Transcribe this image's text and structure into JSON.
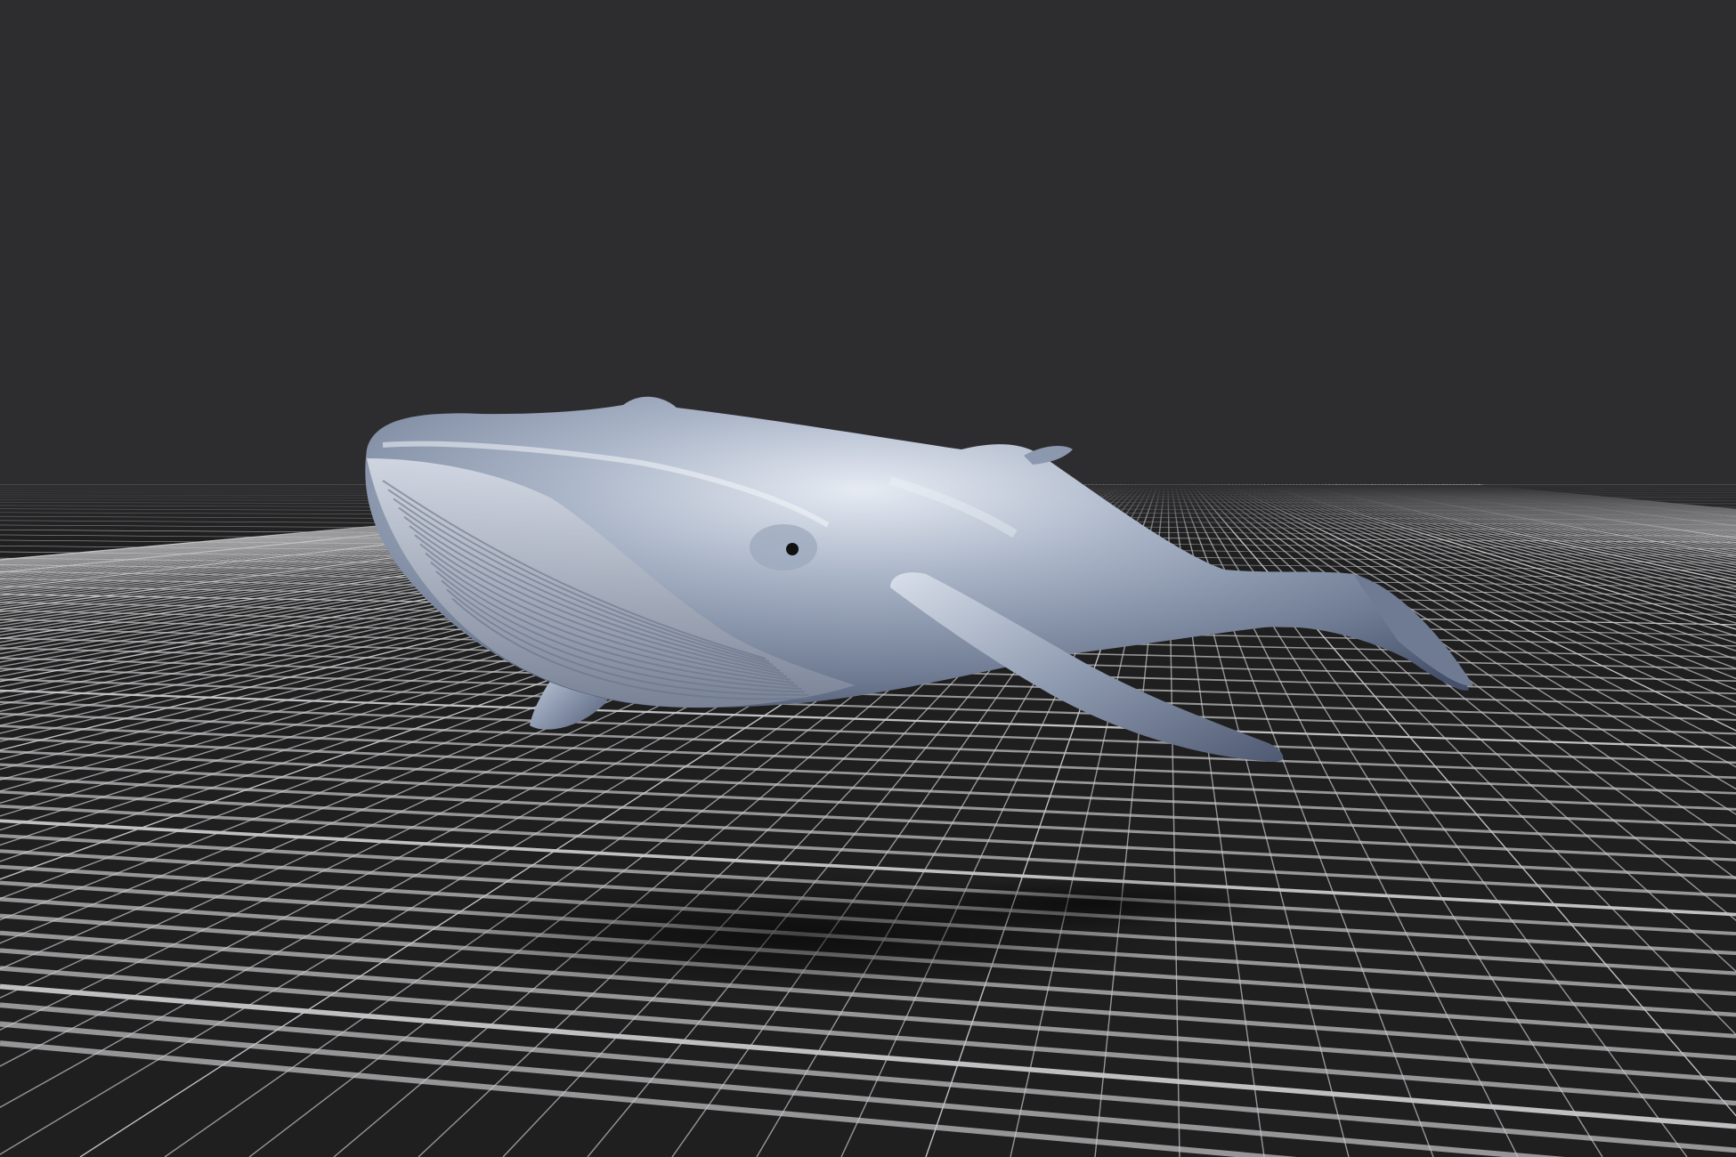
{
  "viewport": {
    "background_color": "#2d2d2f",
    "grid_line_color": "#c9c9cb",
    "grid_fill_color": "#1f1f20"
  },
  "model": {
    "subject": "humpback whale",
    "icon": "whale-model",
    "body_color": "#8a97ad",
    "belly_color": "#b9c2d1",
    "highlight_color": "#eef2f8",
    "shadow_color": "#0c0c0c"
  }
}
